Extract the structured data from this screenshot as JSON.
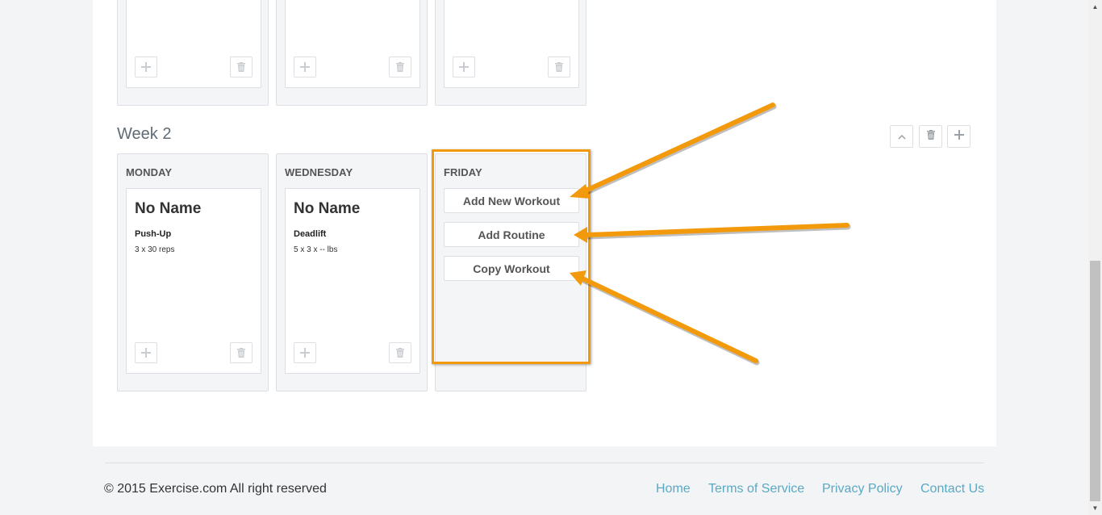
{
  "week1": {
    "days": [
      {
        "add_icon": "plus-icon",
        "delete_icon": "trash-icon"
      },
      {
        "add_icon": "plus-icon",
        "delete_icon": "trash-icon"
      },
      {
        "add_icon": "plus-icon",
        "delete_icon": "trash-icon"
      }
    ]
  },
  "week2": {
    "title": "Week 2",
    "controls": [
      "chevron-up-icon",
      "trash-icon",
      "plus-icon"
    ],
    "days": [
      {
        "name": "MONDAY",
        "workout": {
          "name": "No Name",
          "exercise": "Push-Up",
          "detail": "3 x 30 reps"
        }
      },
      {
        "name": "WEDNESDAY",
        "workout": {
          "name": "No Name",
          "exercise": "Deadlift",
          "detail": "5 x 3 x -- lbs"
        }
      },
      {
        "name": "FRIDAY",
        "actions": [
          "Add New Workout",
          "Add Routine",
          "Copy Workout"
        ]
      }
    ]
  },
  "annotation": {
    "color": "#f29a0c"
  },
  "footer": {
    "copyright": "© 2015 Exercise.com All right reserved",
    "links": [
      "Home",
      "Terms of Service",
      "Privacy Policy",
      "Contact Us"
    ]
  },
  "colors": {
    "link": "#5aa9c4",
    "border": "#dcdfe3",
    "panel": "#f4f5f7"
  }
}
